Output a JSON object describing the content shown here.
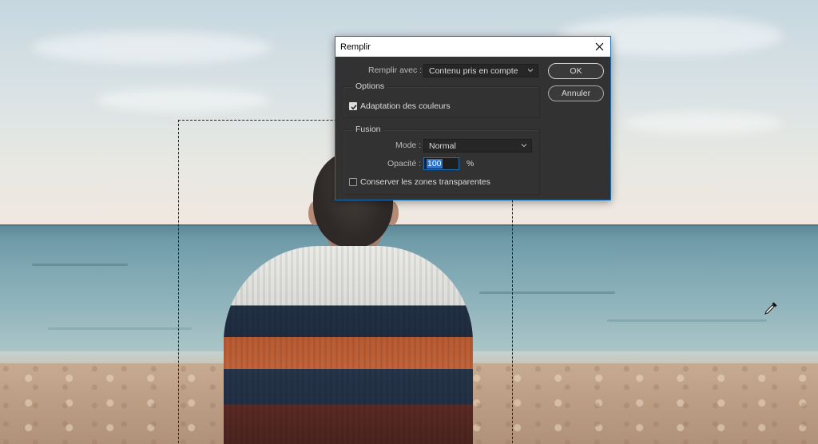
{
  "dialog": {
    "title": "Remplir",
    "close_icon": "close-icon",
    "fill_with_label": "Remplir avec :",
    "fill_with_value": "Contenu pris en compte",
    "options_group_title": "Options",
    "color_adaptation_label": "Adaptation des couleurs",
    "color_adaptation_checked": true,
    "fusion_group_title": "Fusion",
    "mode_label": "Mode :",
    "mode_value": "Normal",
    "opacity_label": "Opacité :",
    "opacity_value": "100",
    "opacity_unit": "%",
    "preserve_transparency_label": "Conserver les zones transparentes",
    "preserve_transparency_checked": false,
    "ok_label": "OK",
    "cancel_label": "Annuler"
  },
  "canvas": {
    "cursor_icon": "eyedropper-icon",
    "accent_color": "#1a6fb7",
    "dialog_bg": "#323232"
  }
}
